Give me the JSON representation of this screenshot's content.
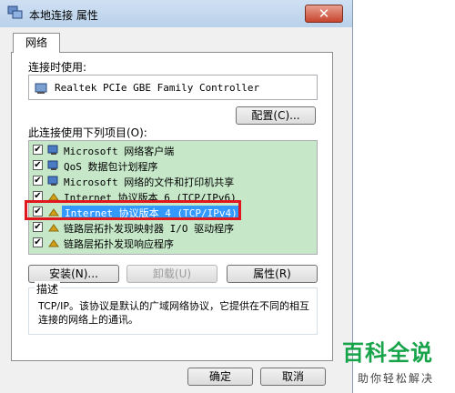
{
  "window": {
    "title": "本地连接 属性",
    "close_label": "✕"
  },
  "tabs": [
    {
      "label": "网络"
    }
  ],
  "connect_using": {
    "label": "连接时使用:",
    "device": "Realtek PCIe GBE Family Controller",
    "configure_button": "配置(C)..."
  },
  "items_section": {
    "label": "此连接使用下列项目(O):",
    "items": [
      {
        "label": "Microsoft 网络客户端",
        "checked": true,
        "icon": "network-client-icon"
      },
      {
        "label": "QoS 数据包计划程序",
        "checked": true,
        "icon": "qos-icon"
      },
      {
        "label": "Microsoft 网络的文件和打印机共享",
        "checked": true,
        "icon": "file-share-icon"
      },
      {
        "label": "Internet 协议版本 6 (TCP/IPv6)",
        "checked": true,
        "icon": "protocol-icon"
      },
      {
        "label": "Internet 协议版本 4 (TCP/IPv4)",
        "checked": true,
        "icon": "protocol-icon",
        "selected": true
      },
      {
        "label": "链路层拓扑发现映射器 I/O 驱动程序",
        "checked": true,
        "icon": "protocol-icon"
      },
      {
        "label": "链路层拓扑发现响应程序",
        "checked": true,
        "icon": "protocol-icon"
      }
    ]
  },
  "actions": {
    "install": "安装(N)...",
    "uninstall": "卸载(U)",
    "properties": "属性(R)"
  },
  "description": {
    "label": "描述",
    "text": "TCP/IP。该协议是默认的广域网络协议，它提供在不同的相互连接的网络上的通讯。"
  },
  "footer": {
    "ok": "确定",
    "cancel": "取消"
  },
  "watermark": {
    "line1": "百科全说",
    "line2": "助你轻松解决"
  },
  "colors": {
    "list_bg": "#c6e8c9",
    "selection": "#3399ff",
    "highlight_box": "#e0181d",
    "watermark": "#16a34a"
  }
}
